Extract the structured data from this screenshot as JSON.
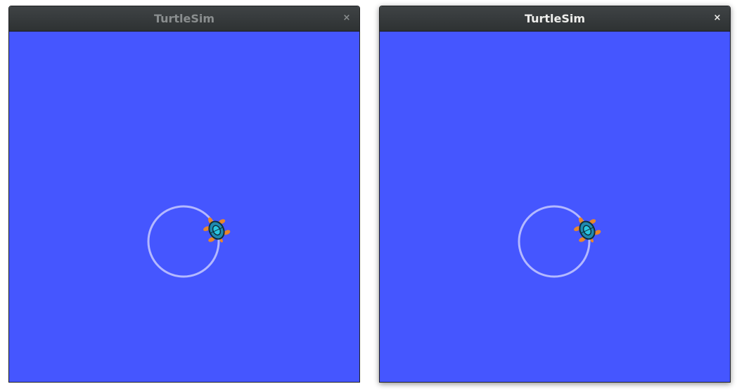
{
  "windows": [
    {
      "title": "TurtleSim",
      "close_glyph": "×",
      "state": "inactive",
      "background_color": "#4556ff",
      "pen_color": "#b3b8ff",
      "pen_path": "circle",
      "turtle_icon": "turtle-icon"
    },
    {
      "title": "TurtleSim",
      "close_glyph": "×",
      "state": "active",
      "background_color": "#4556ff",
      "pen_color": "#b3b8ff",
      "pen_path": "circle",
      "turtle_icon": "turtle-icon"
    }
  ]
}
